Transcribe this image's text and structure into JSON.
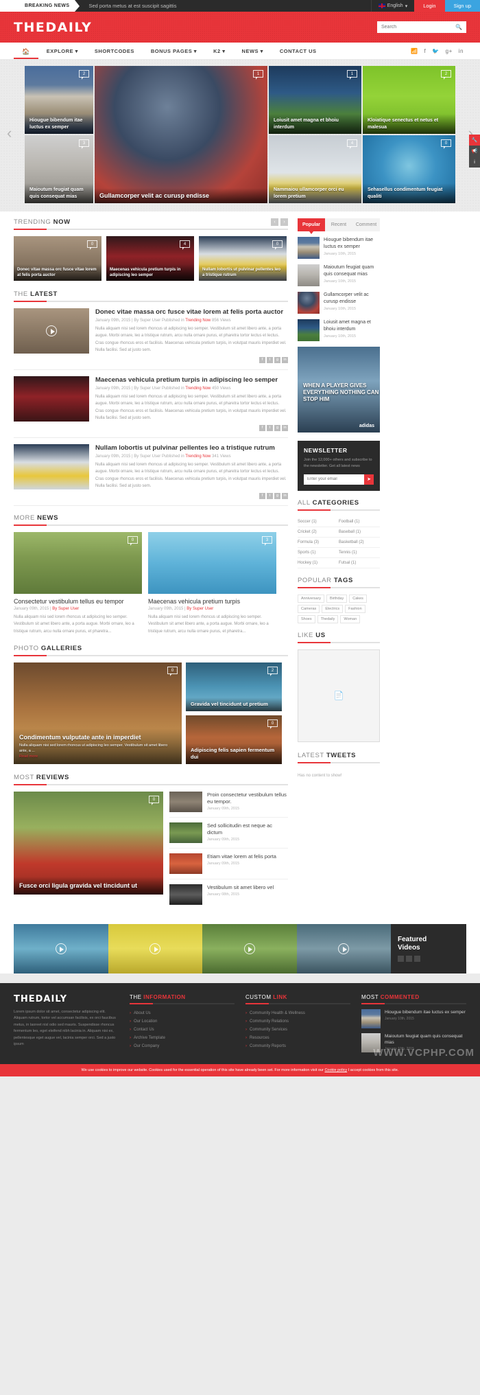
{
  "topbar": {
    "breaking_label": "BREAKING NEWS",
    "breaking_text": "Sed porta metus at est suscipit sagittis",
    "language": "English",
    "login": "Login",
    "signup": "Sign up"
  },
  "header": {
    "logo": "THEDAILY",
    "search_placeholder": "Search",
    "search_value": ""
  },
  "nav": {
    "items": [
      {
        "label": "EXPLORE",
        "caret": true
      },
      {
        "label": "SHORTCODES",
        "caret": false
      },
      {
        "label": "BONUS PAGES",
        "caret": true
      },
      {
        "label": "K2",
        "caret": true
      },
      {
        "label": "NEWS",
        "caret": true
      },
      {
        "label": "CONTACT US",
        "caret": false
      }
    ],
    "social": [
      "rss-icon",
      "facebook-icon",
      "twitter-icon",
      "googleplus-icon",
      "linkedin-icon"
    ]
  },
  "slider": {
    "tiles": [
      {
        "title": "Hiougue bibendum itae luctus ex semper",
        "comments": "2",
        "img": "im-baseball"
      },
      {
        "title": "Maioutum feugiat quam quis consequat mias",
        "comments": "3",
        "img": "im-skate"
      },
      {
        "title": "Gullamcorper velit ac curusp endisse",
        "comments": "1",
        "img": "im-football"
      },
      {
        "title": "Loiusit amet magna et bhoiu interdum",
        "comments": "1",
        "img": "im-soccer"
      },
      {
        "title": "Nammaiou ullamcorper orci eu lorem pretium",
        "comments": "4",
        "img": "im-hockey"
      },
      {
        "title": "Kloiatique senectus et netus et malesua",
        "comments": "2",
        "img": "im-golf"
      },
      {
        "title": "Sehasellus condimentum feugiat qualiti",
        "comments": "0",
        "img": "im-bike"
      }
    ]
  },
  "sidetools": [
    {
      "icon": "wrench-icon",
      "style": "st-red"
    },
    {
      "icon": "megaphone-icon",
      "style": "st-gray"
    },
    {
      "icon": "info-icon",
      "style": "st-gray"
    }
  ],
  "trending": {
    "heading_light": "TRENDING",
    "heading_bold": "NOW",
    "prev": "‹",
    "next": "›",
    "items": [
      {
        "title": "Donec vitae massa orc fusce vitae lorem at felis porta auctor",
        "comments": "0",
        "img": "im-volley"
      },
      {
        "title": "Maecenas vehicula pretium turpis in adipiscing leo semper",
        "comments": "4",
        "img": "im-crowd"
      },
      {
        "title": "Nullam lobortis ut pulvinar pellentes leo a tristique rutrum",
        "comments": "0",
        "img": "im-rink"
      }
    ]
  },
  "latest": {
    "heading_light": "THE",
    "heading_bold": "LATEST",
    "items": [
      {
        "title": "Donec vitae massa orc fusce vitae lorem at felis porta auctor",
        "date": "January 09th, 2015 |",
        "author": "By Super User",
        "published": "Published in",
        "category": "Trending Now",
        "views": "856 Views",
        "text": "Nulla aliquam nisi sed lorem rhoncus ut adipiscing leo semper. Vestibulum sit amet libero ante, a porta augue. Morbi ornare, leo a tristique rutrum, arcu nulla ornare purus, et pharetra tortor lectus et lectus. Cras congue rhoncus eros et facilisis. Maecenas vehicula pretium turpis, in volutpat mauris imperdiet vel. Nulla facilisi. Sed at justo sem.",
        "img": "im-volley",
        "play": true
      },
      {
        "title": "Maecenas vehicula pretium turpis in adipiscing leo semper",
        "date": "January 09th, 2015 |",
        "author": "By Super User",
        "published": "Published in",
        "category": "Trending Now",
        "views": "450 Views",
        "text": "Nulla aliquam nisi sed lorem rhoncus ut adipiscing leo semper. Vestibulum sit amet libero ante, a porta augue. Morbi ornare, leo a tristique rutrum, arcu nulla ornare purus, et pharetra tortor lectus et lectus. Cras congue rhoncus eros et facilisis. Maecenas vehicula pretium turpis, in volutpat mauris imperdiet vel. Nulla facilisi. Sed at justo sem.",
        "img": "im-crowd",
        "play": false
      },
      {
        "title": "Nullam lobortis ut pulvinar pellentes leo a tristique rutrum",
        "date": "January 09th, 2015 |",
        "author": "By Super User",
        "published": "Published in",
        "category": "Trending Now",
        "views": "341 Views",
        "text": "Nulla aliquam nisi sed lorem rhoncus ut adipiscing leo semper. Vestibulum sit amet libero ante, a porta augue. Morbi ornare, leo a tristique rutrum, arcu nulla ornare purus, et pharetra tortor lectus et lectus. Cras congue rhoncus eros et facilisis. Maecenas vehicula pretium turpis, in volutpat mauris imperdiet vel. Nulla facilisi. Sed at justo sem.",
        "img": "im-rink",
        "play": false
      }
    ],
    "share_icons": [
      "facebook-icon",
      "twitter-icon",
      "googleplus-icon",
      "linkedin-icon"
    ]
  },
  "more_news": {
    "heading_light": "MORE",
    "heading_bold": "NEWS",
    "items": [
      {
        "title": "Consectetur vestibulum tellus eu tempor",
        "date": "January 09th, 2015 |",
        "author": "By Super User",
        "comments": "0",
        "img": "im-moto",
        "text": "Nulla aliquam nisi sed lorem rhoncus ut adipiscing leo semper. Vestibulum sit amet libero ante, a porta augue. Morbi ornare, leo a tristique rutrum, arcu nulla ornare purus, et pharetra..."
      },
      {
        "title": "Maecenas vehicula pretium turpis",
        "date": "January 09th, 2015 |",
        "author": "By Super User",
        "comments": "3",
        "img": "im-moto2",
        "text": "Nulla aliquam nisi sed lorem rhoncus ut adipiscing leo semper. Vestibulum sit amet libero ante, a porta augue. Morbi ornare, leo a tristique rutrum, arcu nulla ornare purus, et pharetra..."
      }
    ]
  },
  "galleries": {
    "heading_light": "PHOTO",
    "heading_bold": "GALLERIES",
    "big": {
      "title": "Condimentum vulputate ante in imperdiet",
      "desc": "Nulla aliquam nisi sed lorem rhoncus ut adipiscing leo semper. Vestibulum sit amet libero ante, a ...",
      "read_more": "Read more",
      "comments": "0",
      "img": "im-gym"
    },
    "small": [
      {
        "title": "Gravida vel tincidunt ut pretium",
        "comments": "2",
        "img": "im-swim"
      },
      {
        "title": "Adipiscing felis sapien fermentum dui",
        "comments": "0",
        "img": "im-rugby"
      }
    ]
  },
  "reviews": {
    "heading_light": "MOST",
    "heading_bold": "REVIEWS",
    "big": {
      "title": "Fusce orci ligula gravida vel tincidunt ut",
      "comments": "0",
      "img": "im-nfl"
    },
    "list": [
      {
        "title": "Proin consectetur vestibulum tellus eu tempor.",
        "date": "January 09th, 2015",
        "img": "im-boots"
      },
      {
        "title": "Sed sollicitudin est neque ac dictum",
        "date": "January 09th, 2015",
        "img": "im-horse"
      },
      {
        "title": "Etiam vitae lorem at felis porta",
        "date": "January 09th, 2015",
        "img": "im-track"
      },
      {
        "title": "Vestibulum sit amet libero vel",
        "date": "January 08th, 2015",
        "img": "im-car"
      }
    ]
  },
  "sidebar": {
    "tabs": [
      {
        "label": "Popular",
        "active": true
      },
      {
        "label": "Recent",
        "active": false
      },
      {
        "label": "Comment",
        "active": false
      }
    ],
    "popular": [
      {
        "title": "Hiougue bibendum itae luctus ex semper",
        "date": "January 10th, 2015",
        "img": "im-baseball"
      },
      {
        "title": "Maioutum feugiat quam quis consequat mias",
        "date": "January 10th, 2015",
        "img": "im-skate"
      },
      {
        "title": "Gullamcorper velit ac curusp endisse",
        "date": "January 10th, 2015",
        "img": "im-football"
      },
      {
        "title": "Loiusit amet magna et bhoiu interdum",
        "date": "January 10th, 2015",
        "img": "im-soccer"
      }
    ],
    "ad": {
      "text": "WHEN A PLAYER GIVES EVERYTHING NOTHING CAN STOP HIM",
      "brand": "adidas"
    },
    "newsletter": {
      "title": "NEWSLETTER",
      "desc": "Join the 12,000+ others and subscribe to the newsletter. Get all latest news",
      "placeholder": "Enter your email",
      "button_icon": "send-icon"
    },
    "categories": {
      "heading_light": "ALL",
      "heading_bold": "CATEGORIES",
      "items": [
        "Soccer (1)",
        "Football (1)",
        "Cricket (2)",
        "Baseball (1)",
        "Formula (3)",
        "Basketball (2)",
        "Sports (1)",
        "Tennis (1)",
        "Hockey (1)",
        "Futsal (1)"
      ]
    },
    "tags": {
      "heading_light": "POPULAR",
      "heading_bold": "TAGS",
      "items": [
        "Anniversary",
        "Birthday",
        "Cakes",
        "Cameras",
        "Electrics",
        "Fashion",
        "Shoes",
        "Thedaily",
        "Woman"
      ]
    },
    "like": {
      "heading_light": "LIKE",
      "heading_bold": "US",
      "placeholder_icon": "image-placeholder-icon"
    },
    "tweets": {
      "heading_light": "LATEST",
      "heading_bold": "TWEETS",
      "empty": "Has no content to show!"
    }
  },
  "featured_videos": {
    "label_line1": "Featured",
    "label_line2": "Videos",
    "tiles": [
      "im-kayak",
      "im-yellow",
      "im-volleyb",
      "im-surf"
    ],
    "dots": 3
  },
  "footer": {
    "logo": "THEDAILY",
    "about": "Lorem ipsum dolor sit amet, consectetur adipiscing elit. Aliquam rutrum, tortor vel accumsan facilisis, ex orci faucibus metus, in laoreet nisl odio sed mauris. Suspendisse rhoncus fermentum leo, eget eleifend nibh lacinia in. Aliquam nisi ex, pellentesque eget augue vel, lacinia semper orci. Sed a justo ipsum",
    "col2": {
      "heading_light": "THE",
      "heading_bold": "INFORMATION",
      "links": [
        "About Us",
        "Our Location",
        "Contact Us",
        "Archive Template",
        "Our Company"
      ]
    },
    "col3": {
      "heading_light": "CUSTOM",
      "heading_bold": "LINK",
      "links": [
        "Community Health & Wellness",
        "Community Relations",
        "Community Services",
        "Resources",
        "Community Reports"
      ]
    },
    "col4": {
      "heading_light": "MOST",
      "heading_bold": "COMMENTED",
      "posts": [
        {
          "title": "Hiougue bibendum itae luctus ex semper",
          "date": "January 10th, 2015",
          "img": "im-baseball"
        },
        {
          "title": "Maioutum feugiat quam quis consequat mias",
          "date": "January 10th, 2015",
          "img": "im-skate"
        }
      ]
    },
    "watermark": "WWW.VCPHP.COM"
  },
  "cookiebar": {
    "text": "We use cookies to improve our website. Cookies used for the essential operation of this site have already been set. For more information visit our",
    "link": "Cookie policy",
    "accept": "I accept cookies from this site."
  },
  "colors": {
    "accent": "#e8353a",
    "dark": "#2b2b2b",
    "signup_blue": "#3ba4e0"
  }
}
